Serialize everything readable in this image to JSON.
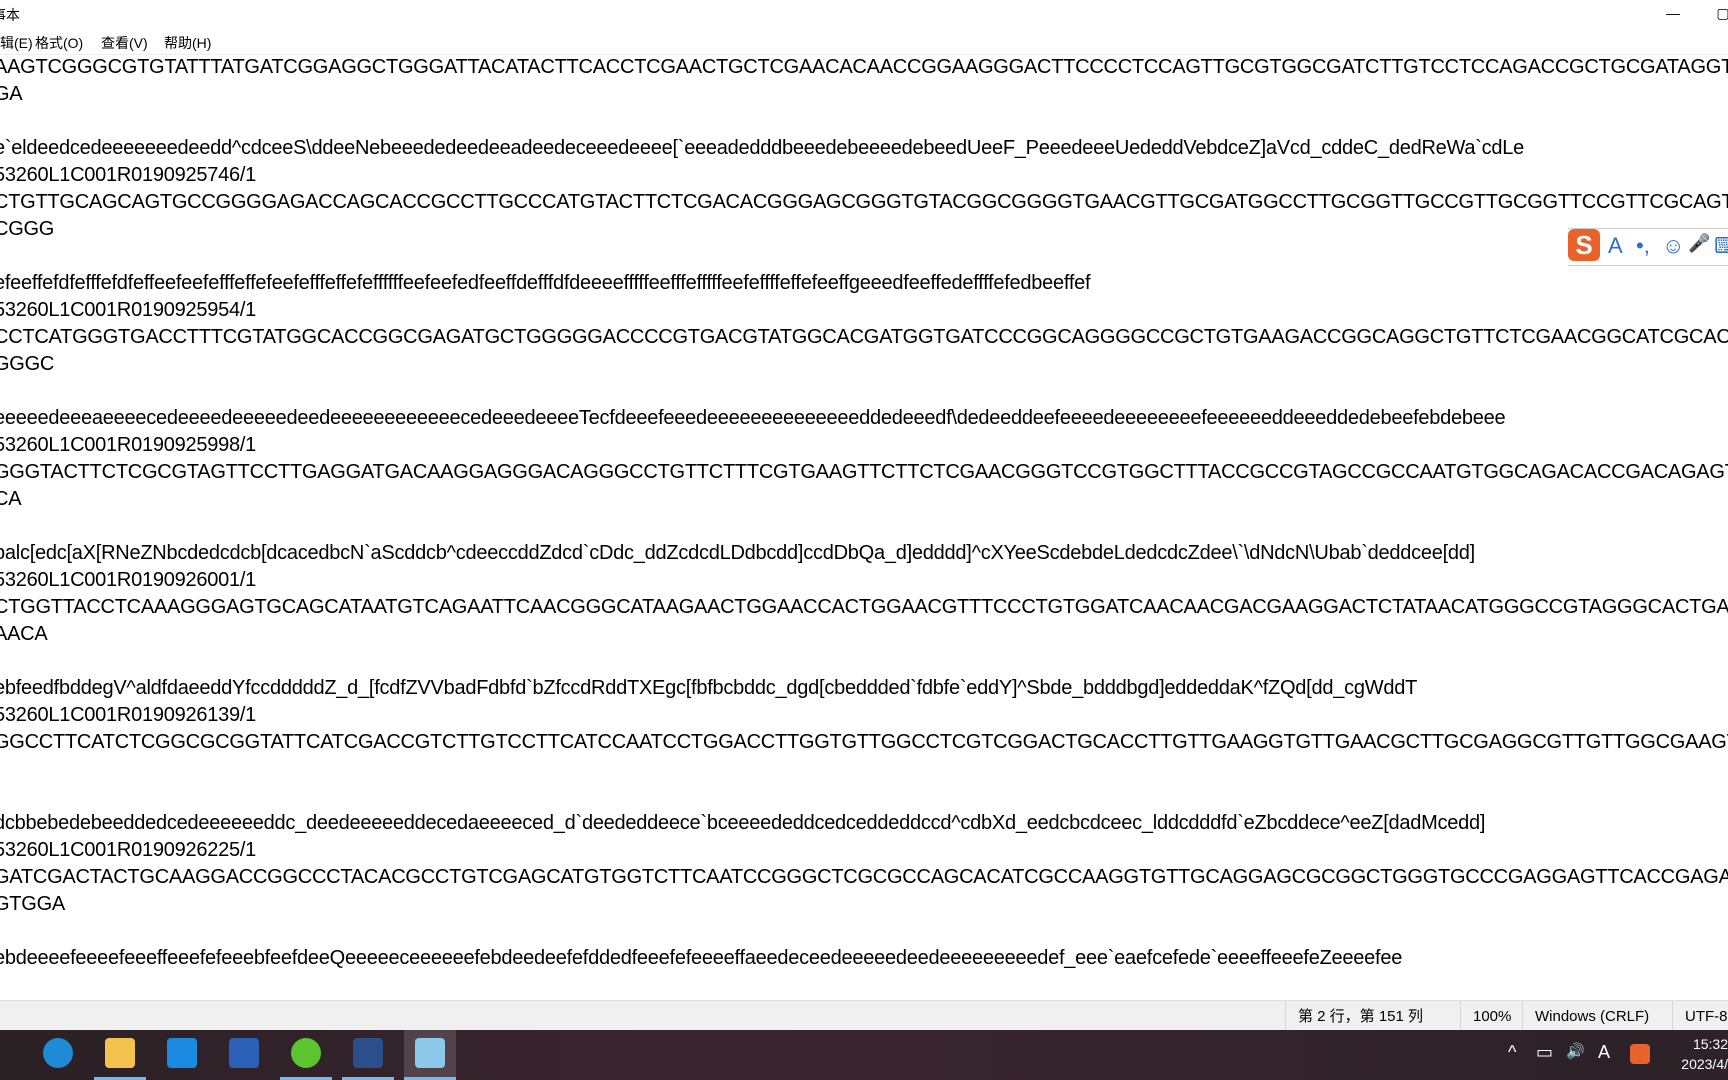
{
  "window": {
    "title": "事本",
    "minimize_icon": "minimize-icon",
    "maximize_icon": "maximize-icon"
  },
  "menu": [
    "编辑(E)",
    "格式(O)",
    "查看(V)",
    "帮助(H)"
  ],
  "editor_lines": [
    "AAGTCGGGCGTGTATTTATGATCGGAGGCTGGGATTACATACTTCACCTCGAACTGCTCGAACACAACCGGAAGGGACTTCCCCTCCAGTTGCGTGGCGATCTTGTCCTCCAGACCGCTGCGATAGGTCGT",
    "GA",
    "",
    "e`eldeedcedeeeeeeedeedd^cdceeS\\ddeeNebeeededeedeeadeedeceeedeeee[`eeeadedddbeeedebeeeedebeedUeeF_PeeedeeeUededdVebdceZ]aVcd_cddeC_dedReWa`cdLe",
    "53260L1C001R0190925746/1",
    "CTGTTGCAGCAGTGCCGGGGAGACCAGCACCGCCTTGCCCATGTACTTCTCGACACGGGAGCGGGTGTACGGCGGGGTGAACGTTGCGATGGCCTTGCGGTTGCCGTTGCGGTTCCGTTCGCAGTCGATC",
    "CGGG",
    "",
    "efeeffefdfefffefdfeffeefeefefffeffefeefefffeffefeffffffeefeefedfeeffdefffdfdeeeefffffeefffefffffeefeffffeffefeeffgeeedfeeffedeffffefedbeeffef",
    "53260L1C001R0190925954/1",
    "CCTCATGGGTGACCTTTCGTATGGCACCGGCGAGATGCTGGGGGACCCCGTGACGTATGGCACGATGGTGATCCCGGCAGGGGCCGCTGTGAAGACCGGCAGGCTGTTCTCGAACGGCATCGCACGGGT",
    "GGGC",
    "",
    "eeeeedeeeaeeeecedeeeedeeeeedeedeeeeeeeeeeeecedeeedeeeeTecfdeeefeeedeeeeeeeeeeeeeeddedeeedf\\dedeeddeefeeeedeeeeeeeefeeeeeeddeeeddedebeefebdebeee",
    "53260L1C001R0190925998/1",
    "GGGTACTTCTCGCGTAGTTCCTTGAGGATGACAAGGAGGGACAGGGCCTGTTCTTTCGTGAAGTTCTTCTCGAACGGGTCCGTGGCTTTACCGCCGTAGCCGCCAATGTGGCAGACACCGACAGAGTGGA",
    "CA",
    "",
    "balc[edc[aX[RNeZNbcdedcdcb[dcacedbcN`aScddcb^cdeeccddZdcd`cDdc_ddZcdcdLDdbcdd]ccdDbQa_d]edddd]^cXYeeScdebdeLdedcdcZdee\\`\\dNdcN\\Ubab`deddcee[dd]",
    "53260L1C001R0190926001/1",
    "CTGGTTACCTCAAAGGGAGTGCAGCATAATGTCAGAATTCAACGGGCATAAGAACTGGAACCACTGGAACGTTTCCCTGTGGATCAACAACGACGAAGGACTCTATAACATGGGCCGTAGGGCACTGAC",
    "AACA",
    "",
    "ebfeedfbddegV^aldfdaeeddYfccdddddZ_d_[fcdfZVVbadFdbfd`bZfccdRddTXEgc[fbfbcbddc_dgd[cbeddded`fdbfe`eddY]^Sbde_bdddbgd]eddeddaK^fZQd[dd_cgWddT",
    "53260L1C001R0190926139/1",
    "GGCCTTCATCTCGGCGCGGTATTCATCGACCGTCTTGTCCTTCATCCAATCCTGGACCTTGGTGTTGGCCTCGTCGGACTGCACCTTGTTGAAGGTGTTGAACGCTTGCGAGGCGTTGTTGGCGAAGTCCGC",
    "",
    "",
    "dcbbebedebeeddedcedeeeeeeddc_deedeeeeeddecedaeeeeced_d`deededdeece`bceeeededdcedceddeddccd^cdbXd_eedcbcdceec_lddcdddfd`eZbcddece^eeZ[dadMcedd]",
    "53260L1C001R0190926225/1",
    "GATCGACTACTGCAAGGACCGGCCCTACACGCCTGTCGAGCATGTGGTCTTCAATCCGGGCTCGCGCCAGCACATCGCCAAGGTGTTGCAGGAGCGCGGCTGGGTGCCCGAGGAGTTCACCGAGACCGC",
    "GTGGA",
    "",
    "ebdeeeefeeeefeeeffeeefefeeebfeefdeeQeeeeeceeeeeefebdeedeefefddedfeeefefeeeeffaeedeceedeeeeedeedeeeeeeeeedef_eee`eaefcefede`eeeeffeeefeZeeeefee"
  ],
  "ime_toolbar": {
    "logo": "S",
    "items": [
      "A",
      "•,",
      "☺",
      "🎤",
      "⌨"
    ]
  },
  "status": {
    "position": "第 2 行，第 151 列",
    "zoom": "100%",
    "line_ending": "Windows (CRLF)",
    "encoding": "UTF-8"
  },
  "taskbar": {
    "apps": [
      {
        "name": "edge",
        "color": "#1f8ad6",
        "running": false
      },
      {
        "name": "file-explorer",
        "color": "#f2c14e",
        "running": true
      },
      {
        "name": "mail",
        "color": "#1a8ae0",
        "running": false
      },
      {
        "name": "word",
        "color": "#2b5fb8",
        "running": false
      },
      {
        "name": "browser-e",
        "color": "#5cc42f",
        "running": true
      },
      {
        "name": "feather-app",
        "color": "#2a4f8a",
        "running": true
      },
      {
        "name": "notepad",
        "color": "#8cc8ea",
        "running": true
      }
    ],
    "tray": [
      "^",
      "▭",
      "🔊",
      "A"
    ],
    "time": "15:32",
    "date": "2023/4/"
  }
}
